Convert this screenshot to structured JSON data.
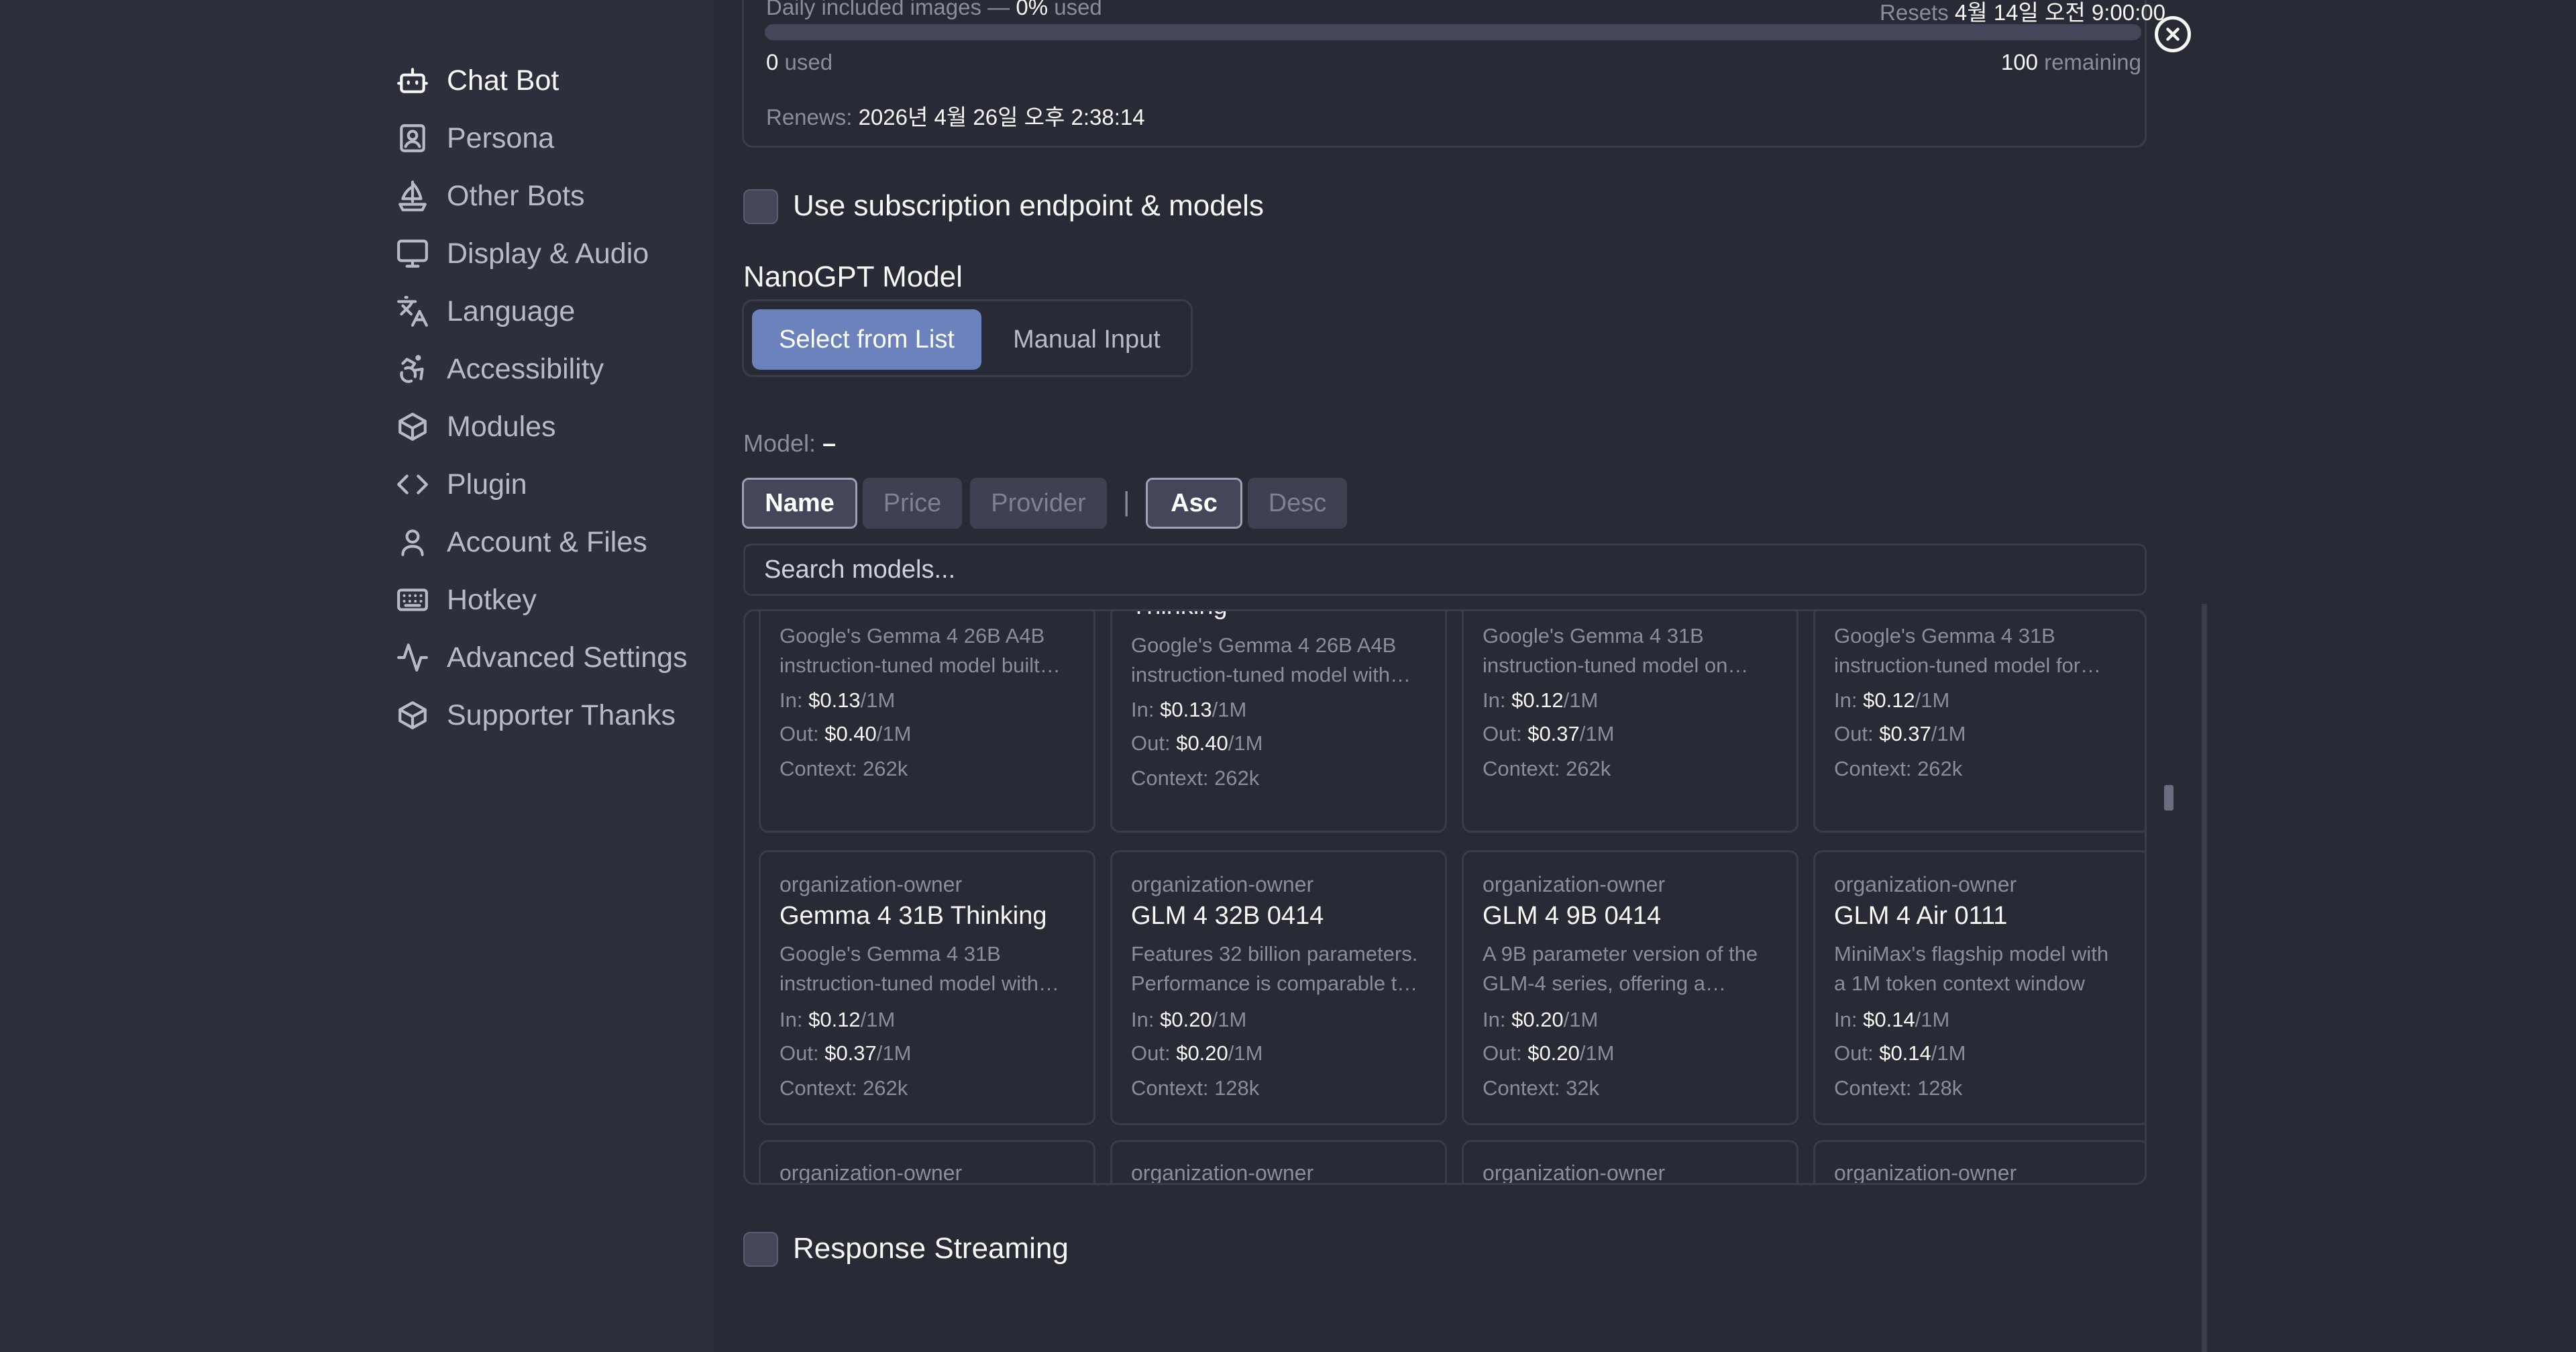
{
  "sidebar": {
    "items": [
      {
        "label": "Chat Bot",
        "icon": "bot-icon",
        "active": true
      },
      {
        "label": "Persona",
        "icon": "persona-icon"
      },
      {
        "label": "Other Bots",
        "icon": "sailboat-icon"
      },
      {
        "label": "Display & Audio",
        "icon": "monitor-icon"
      },
      {
        "label": "Language",
        "icon": "language-icon"
      },
      {
        "label": "Accessibility",
        "icon": "accessibility-icon"
      },
      {
        "label": "Modules",
        "icon": "package-icon"
      },
      {
        "label": "Plugin",
        "icon": "code-icon"
      },
      {
        "label": "Account & Files",
        "icon": "user-icon"
      },
      {
        "label": "Hotkey",
        "icon": "keyboard-icon"
      },
      {
        "label": "Advanced Settings",
        "icon": "activity-icon"
      },
      {
        "label": "Supporter Thanks",
        "icon": "package-icon"
      }
    ]
  },
  "usage": {
    "title_label": "Daily included images — ",
    "title_value": "0%",
    "title_suffix": " used",
    "resets_label": "Resets ",
    "resets_value": "4월 14일 오전 9:00:00",
    "used_value": "0",
    "used_label": " used",
    "remaining_value": "100",
    "remaining_label": " remaining",
    "renews_label": "Renews: ",
    "renews_value": "2026년 4월 26일 오후 2:38:14",
    "progress": 0
  },
  "subscription": {
    "label": "Use subscription endpoint & models",
    "checked": false
  },
  "model_section": {
    "title": "NanoGPT Model",
    "tabs": [
      "Select from List",
      "Manual Input"
    ],
    "model_label": "Model:",
    "model_value": "–"
  },
  "sort": {
    "fields": [
      "Name",
      "Price",
      "Provider"
    ],
    "separator": "|",
    "orders": [
      "Asc",
      "Desc"
    ]
  },
  "search": {
    "placeholder": "Search models..."
  },
  "cards_row1": [
    {
      "name": "",
      "desc1": "Google's Gemma 4 26B A4B",
      "desc2": "instruction-tuned model built…",
      "in": "$0.13",
      "out": "$0.40",
      "context": "262k"
    },
    {
      "name": "Thinking",
      "desc1": "Google's Gemma 4 26B A4B",
      "desc2": "instruction-tuned model with…",
      "in": "$0.13",
      "out": "$0.40",
      "context": "262k"
    },
    {
      "name": "",
      "desc1": "Google's Gemma 4 31B",
      "desc2": "instruction-tuned model on…",
      "in": "$0.12",
      "out": "$0.37",
      "context": "262k"
    },
    {
      "name": "",
      "desc1": "Google's Gemma 4 31B",
      "desc2": "instruction-tuned model for…",
      "in": "$0.12",
      "out": "$0.37",
      "context": "262k"
    }
  ],
  "cards_row2": [
    {
      "owner": "organization-owner",
      "name": "Gemma 4 31B Thinking",
      "desc1": "Google's Gemma 4 31B",
      "desc2": "instruction-tuned model with…",
      "in": "$0.12",
      "out": "$0.37",
      "context": "262k"
    },
    {
      "owner": "organization-owner",
      "name": "GLM 4 32B 0414",
      "desc1": "Features 32 billion parameters.",
      "desc2": "Performance is comparable t…",
      "in": "$0.20",
      "out": "$0.20",
      "context": "128k"
    },
    {
      "owner": "organization-owner",
      "name": "GLM 4 9B 0414",
      "desc1": "A 9B parameter version of the",
      "desc2": "GLM-4 series, offering a…",
      "in": "$0.20",
      "out": "$0.20",
      "context": "32k"
    },
    {
      "owner": "organization-owner",
      "name": "GLM 4 Air 0111",
      "desc1": "MiniMax's flagship model with",
      "desc2": "a 1M token context window",
      "in": "$0.14",
      "out": "$0.14",
      "context": "128k"
    }
  ],
  "cards_row3": [
    {
      "owner": "organization-owner"
    },
    {
      "owner": "organization-owner"
    },
    {
      "owner": "organization-owner"
    },
    {
      "owner": "organization-owner"
    }
  ],
  "labels": {
    "in": "In: ",
    "out": "Out: ",
    "per": "/1M",
    "context": "Context: "
  },
  "streaming": {
    "label": "Response Streaming",
    "checked": false
  },
  "colors": {
    "background": "#282a36",
    "sidebar": "#2d2f3c",
    "accent": "#6b82bd",
    "border": "#3a3c4a"
  }
}
